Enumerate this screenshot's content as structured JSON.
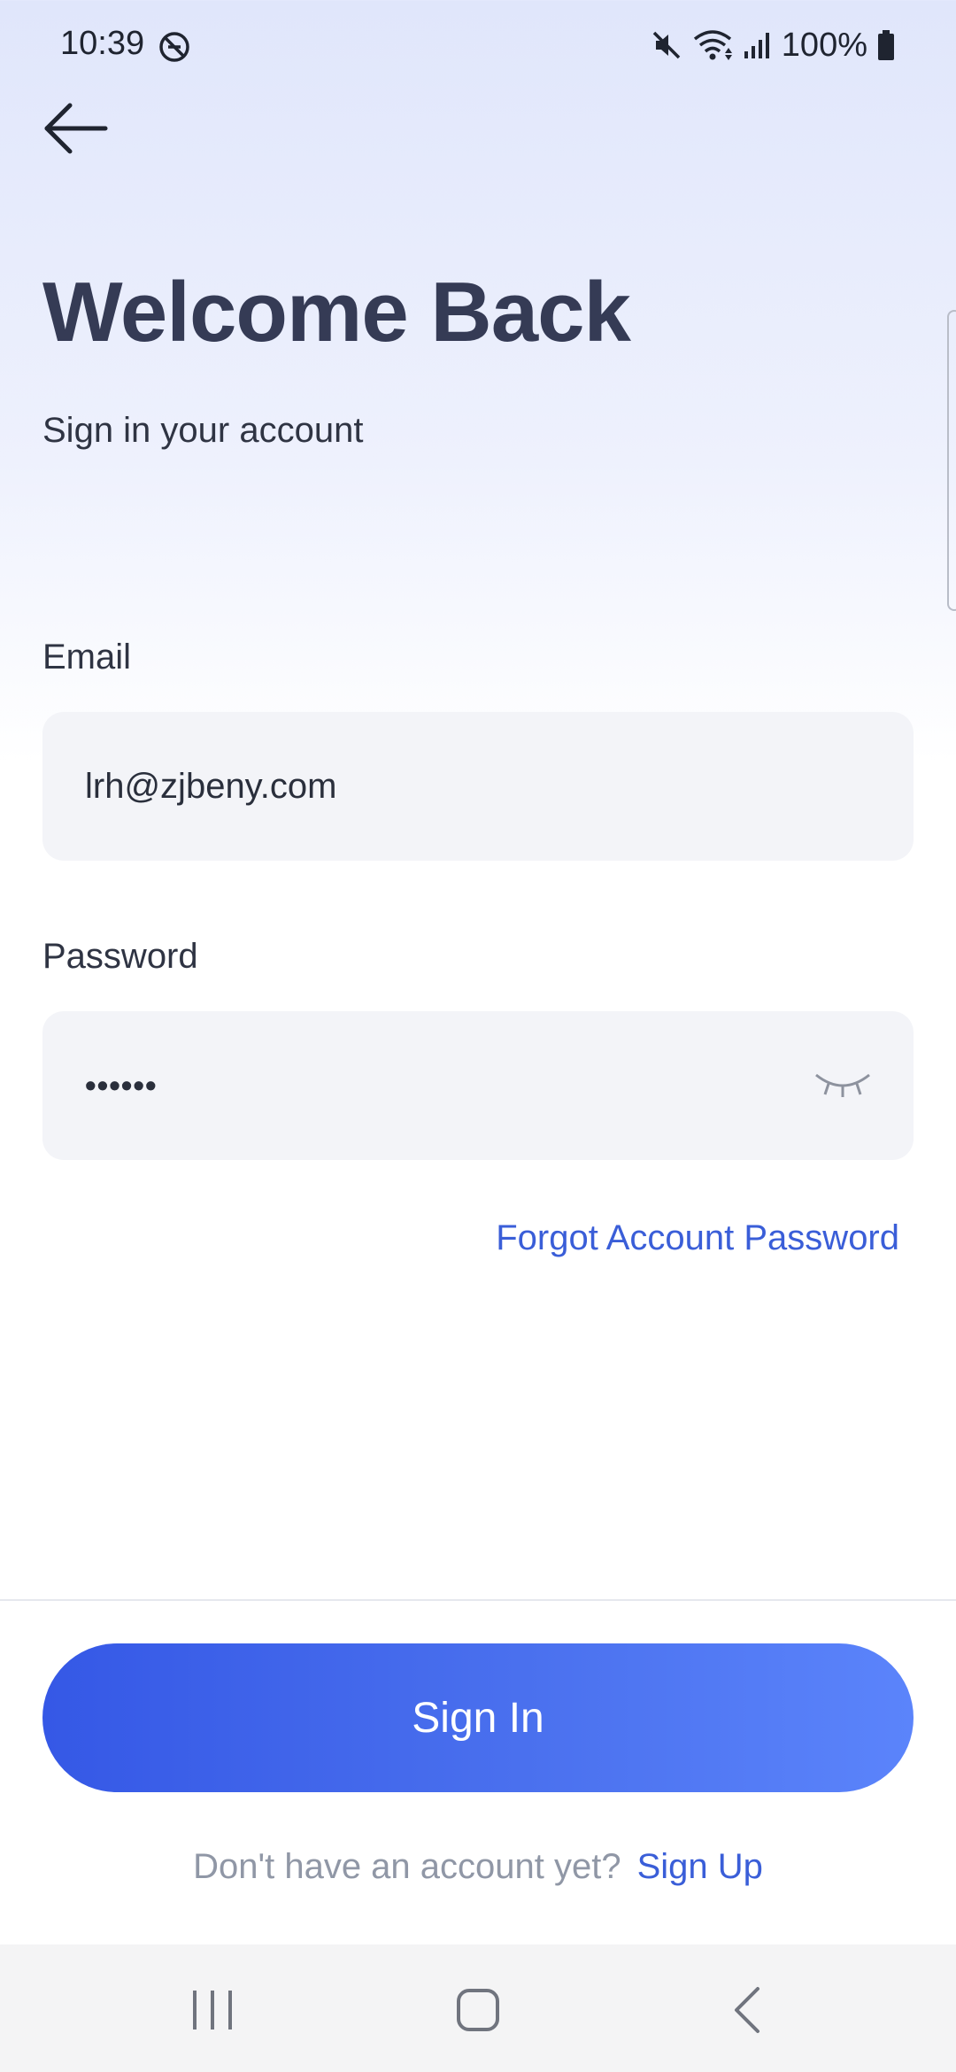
{
  "status_bar": {
    "time": "10:39",
    "battery": "100%",
    "icons": [
      "do-not-disturb-icon",
      "mute-icon",
      "wifi-icon",
      "signal-icon",
      "battery-icon"
    ]
  },
  "header": {
    "title": "Welcome Back",
    "subtitle": "Sign in your account"
  },
  "form": {
    "email_label": "Email",
    "email_value": "lrh@zjbeny.com",
    "password_label": "Password",
    "password_value": "••••••",
    "forgot_label": "Forgot Account Password"
  },
  "actions": {
    "sign_in_label": "Sign In",
    "signup_prompt": "Don't have an account yet?",
    "signup_link": "Sign Up"
  },
  "colors": {
    "accent": "#3a5ed8",
    "button_start": "#3558e6",
    "button_end": "#5b84fb",
    "title": "#353b55"
  }
}
